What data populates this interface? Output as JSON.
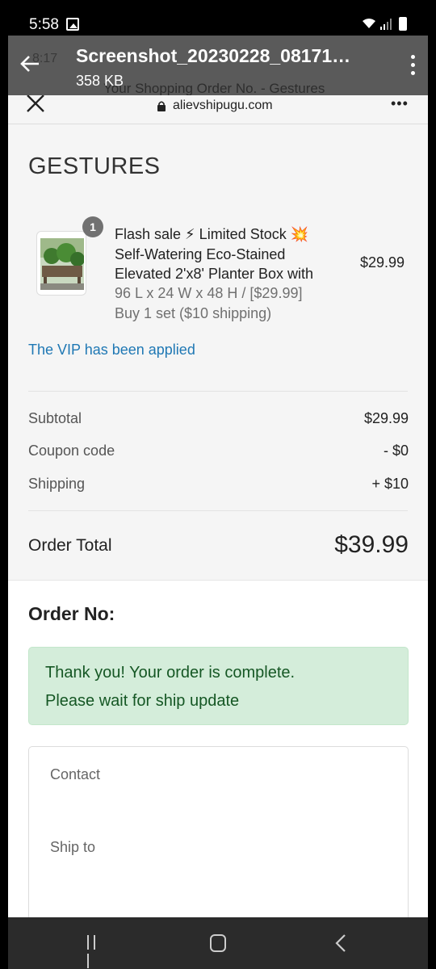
{
  "status_bar": {
    "time": "5:58"
  },
  "viewer": {
    "filename": "Screenshot_20230228_08171…",
    "filesize": "358 KB",
    "ghost_time": "8:17",
    "ghost_title": "Your Shopping Order No. - Gestures"
  },
  "browser": {
    "domain": "alievshipugu.com",
    "menu_label": "•••"
  },
  "store": {
    "name": "GESTURES"
  },
  "item": {
    "quantity": "1",
    "title_lines": [
      "Flash sale ⚡ Limited Stock 💥",
      "Self-Watering Eco-Stained",
      "Elevated 2'x8' Planter Box with"
    ],
    "variant_lines": [
      "96 L x 24 W x 48 H / [$29.99]",
      "Buy 1 set ($10 shipping)"
    ],
    "price": "$29.99"
  },
  "vip_note": "The VIP has been applied",
  "summary": {
    "subtotal_label": "Subtotal",
    "subtotal_value": "$29.99",
    "coupon_label": "Coupon code",
    "coupon_value": "- $0",
    "shipping_label": "Shipping",
    "shipping_value": "+ $10"
  },
  "total": {
    "label": "Order Total",
    "value": "$39.99"
  },
  "order": {
    "heading": "Order No:",
    "message_lines": [
      "Thank you! Your order is complete.",
      "Please wait for ship update"
    ]
  },
  "info": {
    "contact_label": "Contact",
    "ship_to_label": "Ship to"
  }
}
